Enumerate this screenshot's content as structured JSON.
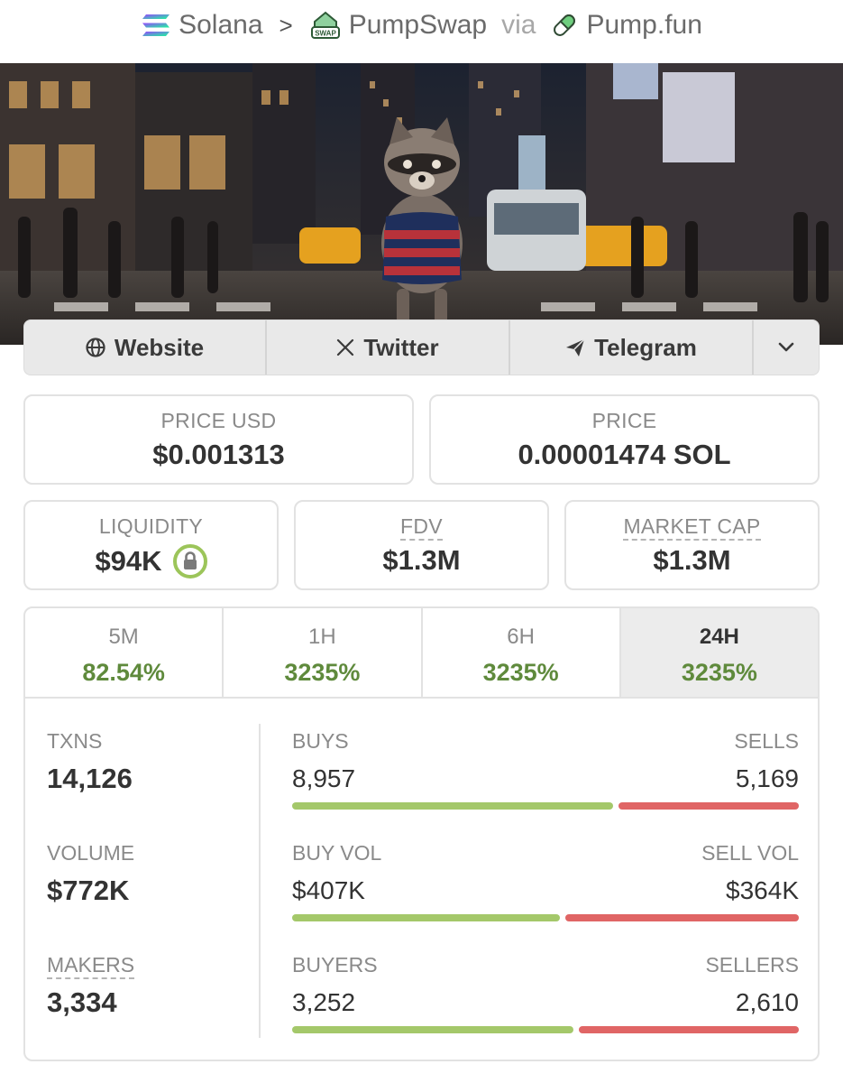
{
  "breadcrumb": {
    "chain": "Solana",
    "dex": "PumpSwap",
    "dex_icon_text": "SWAP",
    "via": "via",
    "launchpad": "Pump.fun"
  },
  "links": {
    "website": "Website",
    "twitter": "Twitter",
    "telegram": "Telegram"
  },
  "price": {
    "usd_label": "PRICE USD",
    "usd_value": "$0.001313",
    "native_label": "PRICE",
    "native_value": "0.00001474 SOL"
  },
  "metrics": {
    "liquidity_label": "LIQUIDITY",
    "liquidity_value": "$94K",
    "fdv_label": "FDV",
    "fdv_value": "$1.3M",
    "mcap_label": "MARKET CAP",
    "mcap_value": "$1.3M"
  },
  "periods": [
    {
      "label": "5M",
      "change": "82.54%"
    },
    {
      "label": "1H",
      "change": "3235%"
    },
    {
      "label": "6H",
      "change": "3235%"
    },
    {
      "label": "24H",
      "change": "3235%",
      "active": true
    }
  ],
  "stats": {
    "txns_label": "TXNS",
    "txns_value": "14,126",
    "volume_label": "VOLUME",
    "volume_value": "$772K",
    "makers_label": "MAKERS",
    "makers_value": "3,334",
    "buys_label": "BUYS",
    "buys_value": "8,957",
    "sells_label": "SELLS",
    "sells_value": "5,169",
    "buy_vol_label": "BUY VOL",
    "buy_vol_value": "$407K",
    "sell_vol_label": "SELL VOL",
    "sell_vol_value": "$364K",
    "buyers_label": "BUYERS",
    "buyers_value": "3,252",
    "sellers_label": "SELLERS",
    "sellers_value": "2,610",
    "buy_share": 0.634,
    "buy_vol_share": 0.528,
    "buyers_share": 0.555
  },
  "colors": {
    "positive": "#5f8a3c",
    "buy_bar": "#a4c86a",
    "sell_bar": "#e06565"
  }
}
